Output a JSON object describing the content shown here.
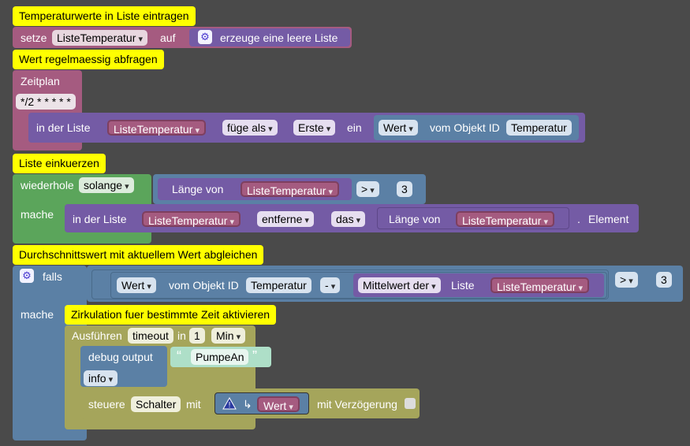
{
  "comments": {
    "c1": "Temperaturwerte in Liste eintragen",
    "c2": "Wert regelmaessig abfragen",
    "c3": "Liste einkuerzen",
    "c4": "Durchschnittswert mit aktuellem Wert abgleichen",
    "c5": "Zirkulation fuer bestimmte Zeit aktivieren"
  },
  "set_block": {
    "label": "setze",
    "variable": "ListeTemperatur",
    "on": "auf",
    "create": "erzeuge eine leere Liste"
  },
  "schedule": {
    "label": "Zeitplan",
    "cron": "*/2 * * * * *"
  },
  "insert": {
    "in_list": "in der Liste",
    "variable": "ListeTemperatur",
    "mode": "füge als",
    "position": "Erste",
    "in": "ein",
    "value": "Wert",
    "of_object": "vom Objekt ID",
    "object_id": "Temperatur"
  },
  "while": {
    "repeat": "wiederhole",
    "mode": "solange",
    "length_of": "Länge von",
    "variable": "ListeTemperatur",
    "op": ">",
    "num": "3",
    "do": "mache"
  },
  "remove": {
    "in_list": "in der Liste",
    "variable": "ListeTemperatur",
    "action": "entferne",
    "which": "das",
    "length_of": "Länge von",
    "variable2": "ListeTemperatur",
    "dot": ".",
    "element": "Element"
  },
  "if_block": {
    "if": "falls",
    "value": "Wert",
    "of_object": "vom Objekt ID",
    "object_id": "Temperatur",
    "minus": "-",
    "average": "Mittelwert der",
    "list": "Liste",
    "variable": "ListeTemperatur",
    "op": ">",
    "num": "3",
    "do": "mache"
  },
  "timeout": {
    "run": "Ausführen",
    "name": "timeout",
    "in": "in",
    "num": "1",
    "unit": "Min"
  },
  "debug": {
    "label": "debug output",
    "open_quote": "“",
    "text": "PumpeAn",
    "close_quote": "”",
    "level": "info"
  },
  "control": {
    "label": "steuere",
    "device": "Schalter",
    "with": "mit",
    "value": "Wert",
    "delay": "mit Verzögerung"
  },
  "colors": {
    "purple": "#9a5ba5",
    "list": "#745ba5",
    "green": "#5ba55b",
    "blue": "#5b80a5",
    "olive": "#a5a55b",
    "comment": "#ffff00"
  }
}
